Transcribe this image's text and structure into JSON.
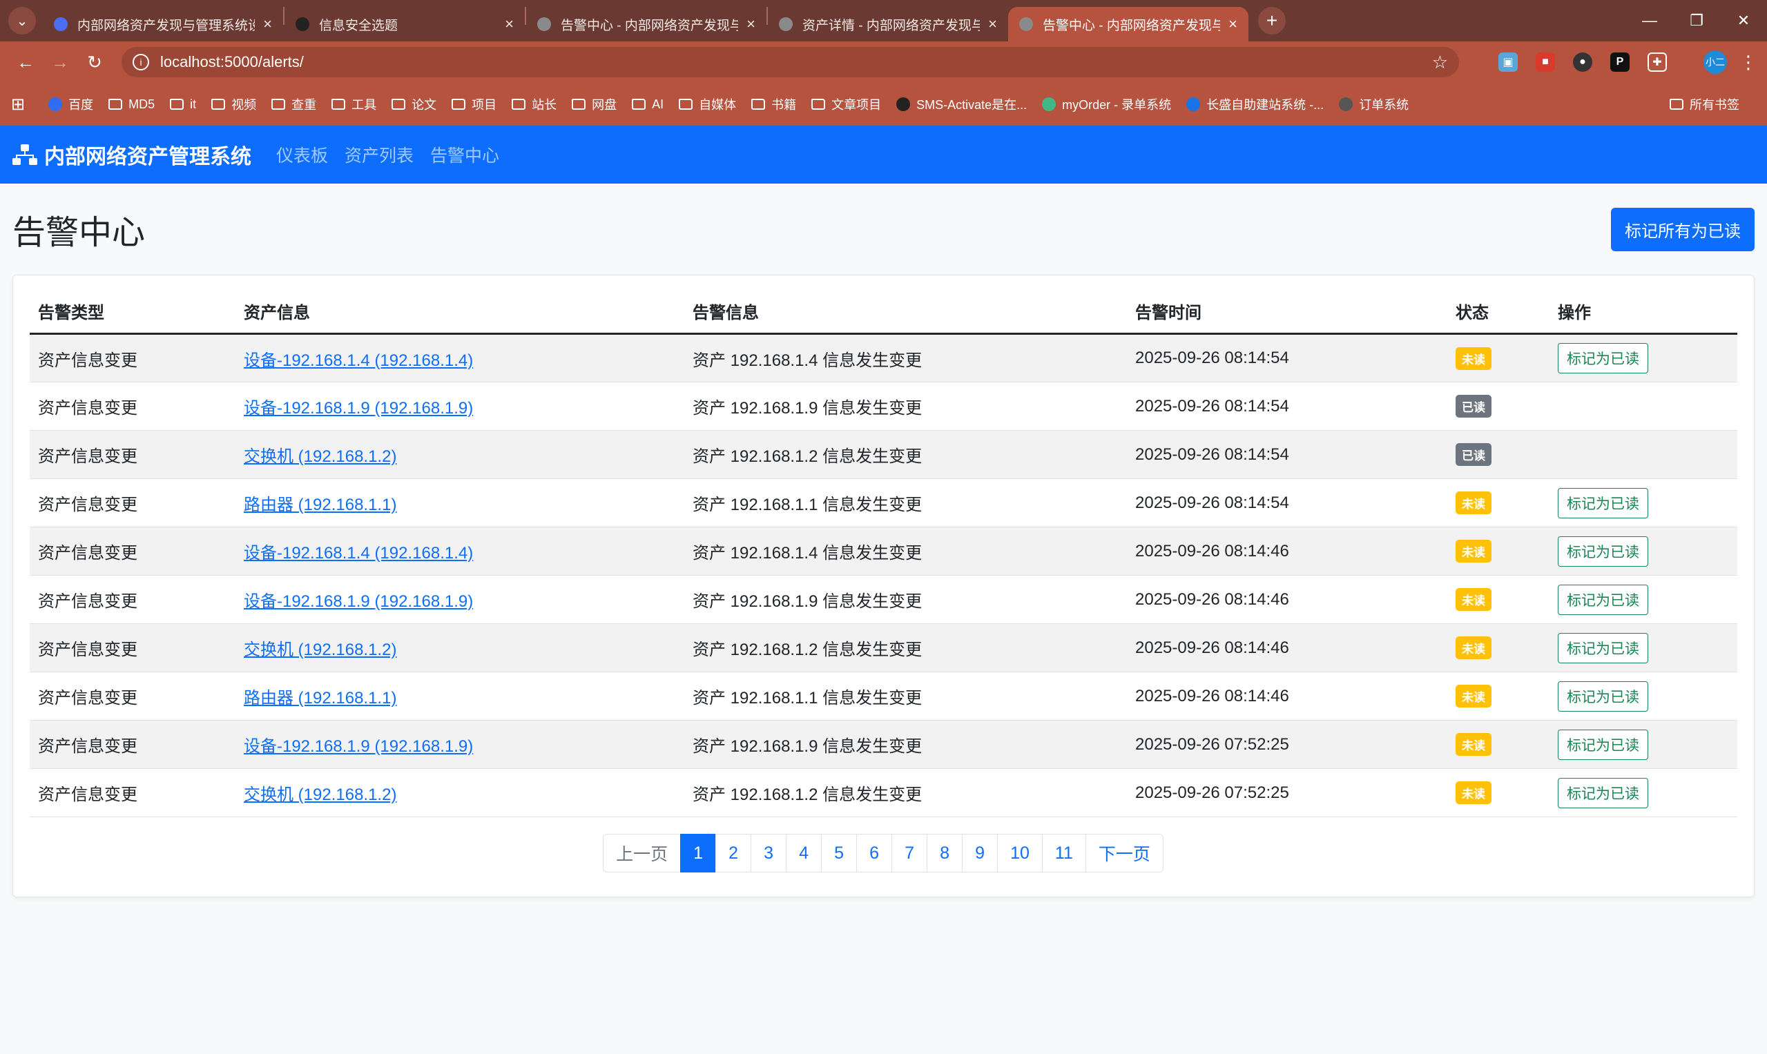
{
  "browser": {
    "tabs": [
      {
        "title": "内部网络资产发现与管理系统设计",
        "favicon_color": "#4c6ef5",
        "active": false
      },
      {
        "title": "信息安全选题",
        "favicon_color": "#222222",
        "active": false
      },
      {
        "title": "告警中心 - 内部网络资产发现与",
        "favicon_color": "#8a8a8a",
        "active": false
      },
      {
        "title": "资产详情 - 内部网络资产发现与",
        "favicon_color": "#8a8a8a",
        "active": false
      },
      {
        "title": "告警中心 - 内部网络资产发现与",
        "favicon_color": "#8a8a8a",
        "active": true
      }
    ],
    "url": "localhost:5000/alerts/",
    "profile_label": "小二",
    "bookmarks": [
      {
        "label": "百度",
        "icon": "baidu-icon"
      },
      {
        "label": "MD5",
        "icon": "folder-icon"
      },
      {
        "label": "it",
        "icon": "folder-icon"
      },
      {
        "label": "视频",
        "icon": "folder-icon"
      },
      {
        "label": "查重",
        "icon": "folder-icon"
      },
      {
        "label": "工具",
        "icon": "folder-icon"
      },
      {
        "label": "论文",
        "icon": "folder-icon"
      },
      {
        "label": "项目",
        "icon": "folder-icon"
      },
      {
        "label": "站长",
        "icon": "folder-icon"
      },
      {
        "label": "网盘",
        "icon": "folder-icon"
      },
      {
        "label": "AI",
        "icon": "folder-icon"
      },
      {
        "label": "自媒体",
        "icon": "folder-icon"
      },
      {
        "label": "书籍",
        "icon": "folder-icon"
      },
      {
        "label": "文章项目",
        "icon": "folder-icon"
      },
      {
        "label": "SMS-Activate是在...",
        "icon": "sms-icon"
      },
      {
        "label": "myOrder - 录单系统",
        "icon": "vue-icon"
      },
      {
        "label": "长盛自助建站系统 -...",
        "icon": "site-icon"
      },
      {
        "label": "订单系统",
        "icon": "order-icon"
      }
    ],
    "all_bookmarks_label": "所有书签"
  },
  "app": {
    "brand": "内部网络资产管理系统",
    "nav": [
      "仪表板",
      "资产列表",
      "告警中心"
    ]
  },
  "page": {
    "title": "告警中心",
    "mark_all_label": "标记所有为已读",
    "columns": [
      "告警类型",
      "资产信息",
      "告警信息",
      "告警时间",
      "状态",
      "操作"
    ],
    "rows": [
      {
        "type": "资产信息变更",
        "asset": "设备-192.168.1.4 (192.168.1.4)",
        "message": "资产 192.168.1.4 信息发生变更",
        "time": "2025-09-26 08:14:54",
        "status": "未读",
        "status_kind": "unread",
        "action": "标记为已读"
      },
      {
        "type": "资产信息变更",
        "asset": "设备-192.168.1.9 (192.168.1.9)",
        "message": "资产 192.168.1.9 信息发生变更",
        "time": "2025-09-26 08:14:54",
        "status": "已读",
        "status_kind": "read",
        "action": ""
      },
      {
        "type": "资产信息变更",
        "asset": "交换机 (192.168.1.2)",
        "message": "资产 192.168.1.2 信息发生变更",
        "time": "2025-09-26 08:14:54",
        "status": "已读",
        "status_kind": "read",
        "action": ""
      },
      {
        "type": "资产信息变更",
        "asset": "路由器 (192.168.1.1)",
        "message": "资产 192.168.1.1 信息发生变更",
        "time": "2025-09-26 08:14:54",
        "status": "未读",
        "status_kind": "unread",
        "action": "标记为已读"
      },
      {
        "type": "资产信息变更",
        "asset": "设备-192.168.1.4 (192.168.1.4)",
        "message": "资产 192.168.1.4 信息发生变更",
        "time": "2025-09-26 08:14:46",
        "status": "未读",
        "status_kind": "unread",
        "action": "标记为已读"
      },
      {
        "type": "资产信息变更",
        "asset": "设备-192.168.1.9 (192.168.1.9)",
        "message": "资产 192.168.1.9 信息发生变更",
        "time": "2025-09-26 08:14:46",
        "status": "未读",
        "status_kind": "unread",
        "action": "标记为已读"
      },
      {
        "type": "资产信息变更",
        "asset": "交换机 (192.168.1.2)",
        "message": "资产 192.168.1.2 信息发生变更",
        "time": "2025-09-26 08:14:46",
        "status": "未读",
        "status_kind": "unread",
        "action": "标记为已读"
      },
      {
        "type": "资产信息变更",
        "asset": "路由器 (192.168.1.1)",
        "message": "资产 192.168.1.1 信息发生变更",
        "time": "2025-09-26 08:14:46",
        "status": "未读",
        "status_kind": "unread",
        "action": "标记为已读"
      },
      {
        "type": "资产信息变更",
        "asset": "设备-192.168.1.9 (192.168.1.9)",
        "message": "资产 192.168.1.9 信息发生变更",
        "time": "2025-09-26 07:52:25",
        "status": "未读",
        "status_kind": "unread",
        "action": "标记为已读"
      },
      {
        "type": "资产信息变更",
        "asset": "交换机 (192.168.1.2)",
        "message": "资产 192.168.1.2 信息发生变更",
        "time": "2025-09-26 07:52:25",
        "status": "未读",
        "status_kind": "unread",
        "action": "标记为已读"
      }
    ],
    "pagination": {
      "prev": "上一页",
      "next": "下一页",
      "pages": [
        "1",
        "2",
        "3",
        "4",
        "5",
        "6",
        "7",
        "8",
        "9",
        "10",
        "11"
      ],
      "current": "1"
    }
  },
  "colors": {
    "primary": "#0d6efd",
    "unread_badge": "#ffc107",
    "read_badge": "#6c757d",
    "success_outline": "#198754",
    "browser_theme": "#b5533f"
  }
}
